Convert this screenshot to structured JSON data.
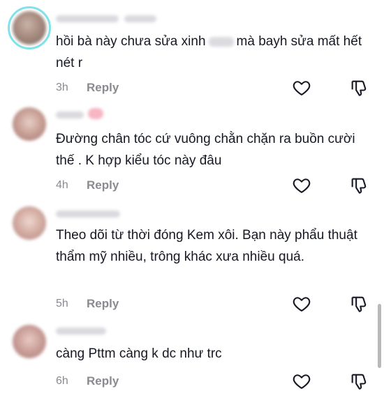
{
  "comments": [
    {
      "text_a": "hồi bà này chưa sửa xinh",
      "text_b": "mà bayh sửa mất hết nét r",
      "time": "3h",
      "reply": "Reply"
    },
    {
      "text": "Đường chân tóc cứ vuông chằn chặn ra buồn cười thế . K hợp kiểu tóc này đâu",
      "time": "4h",
      "reply": "Reply"
    },
    {
      "text": "Theo dõi từ thời đóng Kem xôi. Bạn này phẩu thuật thẩm mỹ nhiều, trông khác xưa nhiều quá.",
      "time": "5h",
      "reply": "Reply"
    },
    {
      "text": "càng Pttm càng k dc như trc",
      "time": "6h",
      "reply": "Reply"
    }
  ],
  "icons": {
    "like": "heart-icon",
    "dislike": "thumbs-down-icon"
  },
  "colors": {
    "text": "#161823",
    "meta": "#8a8b91",
    "ring": "#7fe3ea"
  }
}
